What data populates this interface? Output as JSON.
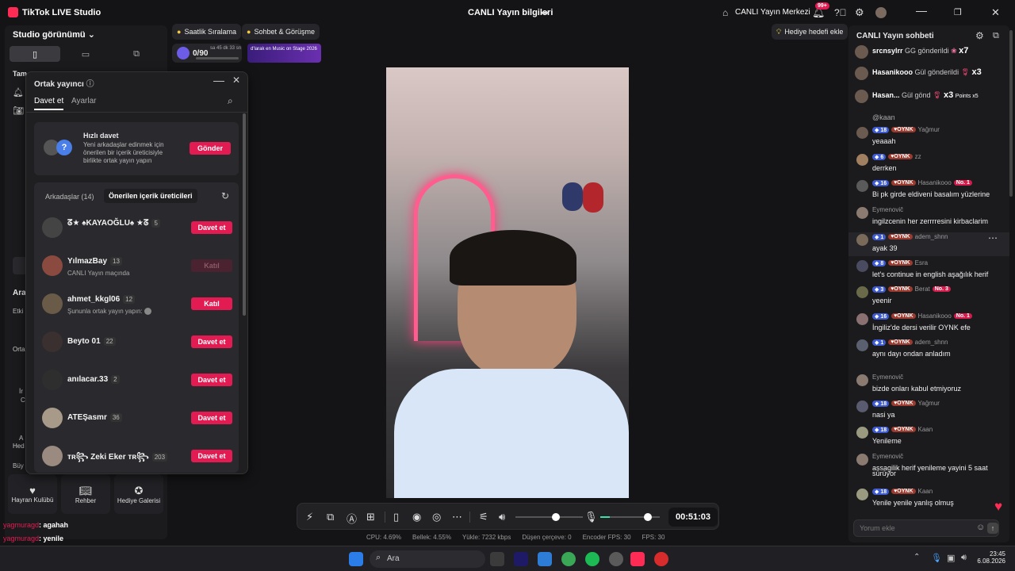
{
  "app": {
    "title": "TikTok LIVE Studio",
    "center_title": "CANLI Yayın bilgileri",
    "live_center": "CANLI Yayın Merkezi",
    "notif_badge": "99+"
  },
  "top_pills": {
    "ranking": "Saatlik Sıralama",
    "chat_meet": "Sohbet & Görüşme",
    "gift_goal": "Hediye hedefi ekle",
    "progress": "0/90",
    "timer": "sa 45 dk 33 sn",
    "banner": "d'larak en Music on Stage 2026"
  },
  "left": {
    "studio_view": "Studio görünümü",
    "tam": "Tam",
    "ara": "Ara",
    "etki": "Etki",
    "orta": "Orta",
    "ir": "İr",
    "c": "C",
    "a": "A",
    "hed": "Hed",
    "buy": "Büy",
    "cards": [
      {
        "label": "Hayran Kulübü"
      },
      {
        "label": "Rehber"
      },
      {
        "label": "Hediye Galerisi"
      }
    ],
    "overlay_chat": [
      {
        "user": "yagmuragd",
        "text": ": agahah"
      },
      {
        "user": "yagmuragd",
        "text": ": yenile"
      }
    ]
  },
  "modal": {
    "title": "Ortak yayıncı",
    "tabs": [
      "Davet et",
      "Ayarlar"
    ],
    "quick": {
      "title": "Hızlı davet",
      "desc": "Yeni arkadaşlar edinmek için önerilen bir içerik üreticisiyle birlikte ortak yayın yapın",
      "button": "Gönder"
    },
    "segments": [
      "Arkadaşlar (14)",
      "Önerilen içerik üreticileri"
    ],
    "users": [
      {
        "name": "ᘔ★ ♠KAYAOĞLU♠ ★ᘔ",
        "count": "5",
        "sub": "",
        "button": "Davet et",
        "state": "active"
      },
      {
        "name": "YılmazBay",
        "count": "13",
        "sub": "CANLI Yayın maçında",
        "button": "Katıl",
        "state": "disabled"
      },
      {
        "name": "ahmet_kkgl06",
        "count": "12",
        "sub": "Şununla ortak yayın yapın:",
        "button": "Katıl",
        "state": "active"
      },
      {
        "name": "Beyto 01",
        "count": "22",
        "sub": "",
        "button": "Davet et",
        "state": "active"
      },
      {
        "name": "anılacar.33",
        "count": "2",
        "sub": "",
        "button": "Davet et",
        "state": "active"
      },
      {
        "name": "ATEŞasmr",
        "count": "36",
        "sub": "",
        "button": "Davet et",
        "state": "active"
      },
      {
        "name": "ᴛʀ꧂ Zeki Eker ᴛʀ꧂",
        "count": "203",
        "sub": "",
        "button": "Davet et",
        "state": "active"
      }
    ]
  },
  "controls": {
    "timer": "00:51:03",
    "volume_level": 0.6,
    "mic_level": 0.8
  },
  "stats": [
    "CPU:  4.69%",
    "Bellek:  4.55%",
    "Yükle:  7232 kbps",
    "Düşen çerçeve:  0",
    "Encoder FPS:  30",
    "FPS:  30"
  ],
  "chat": {
    "title": "CANLI Yayın sohbeti",
    "gifts": [
      {
        "user": "srcnsylrr",
        "action": "GG gönderildi",
        "mult": "x7"
      },
      {
        "user": "Hasanikooo",
        "action": "Gül gönderildi",
        "mult": "x3"
      },
      {
        "user": "Hasan...",
        "action": "Gül gönd",
        "mult": "x3",
        "extra": "Points x5"
      }
    ],
    "cut_text": "@kaan",
    "messages": [
      {
        "lvl": "18",
        "fan": "OYNK",
        "user": "Yağmur",
        "no": "",
        "text": "yeaaah"
      },
      {
        "lvl": "6",
        "fan": "OYNK",
        "user": "zz",
        "no": "",
        "text": "derrken"
      },
      {
        "lvl": "16",
        "fan": "OYNK",
        "user": "Hasanikooo",
        "no": "No. 1",
        "text": "Bi pk girde eldiveni basalım yüzlerine"
      },
      {
        "lvl": "",
        "fan": "",
        "user": "Eymenovič",
        "no": "",
        "text": "ingilzcenin her zerrrresini kirbaclarim"
      },
      {
        "lvl": "1",
        "fan": "OYNK",
        "user": "adem_shnn",
        "no": "",
        "text": "ayak 39"
      },
      {
        "lvl": "8",
        "fan": "OYNK",
        "user": "Esra",
        "no": "",
        "text": "let's continue in english aşağılık herif"
      },
      {
        "lvl": "3",
        "fan": "OYNK",
        "user": "Berat",
        "no": "No. 3",
        "text": "yeenir"
      },
      {
        "lvl": "16",
        "fan": "OYNK",
        "user": "Hasanikooo",
        "no": "No. 1",
        "text": "İngiliz'de dersi verilir OYNK efe"
      },
      {
        "lvl": "1",
        "fan": "OYNK",
        "user": "adem_shnn",
        "no": "",
        "text": "aynı dayı ondan anladım"
      },
      {
        "lvl": "",
        "fan": "",
        "user": "Eymenovič",
        "no": "",
        "text": "bizde onları kabul etmiyoruz"
      },
      {
        "lvl": "18",
        "fan": "OYNK",
        "user": "Yağmur",
        "no": "",
        "text": "nasi ya"
      },
      {
        "lvl": "18",
        "fan": "OYNK",
        "user": "Kaan",
        "no": "",
        "text": "Yenileme"
      },
      {
        "lvl": "",
        "fan": "",
        "user": "Eymenovič",
        "no": "",
        "text": "assagilik herif yenileme yayini 5 saat"
      },
      {
        "lvl": "",
        "fan": "",
        "user": "",
        "no": "",
        "text": "sürüyor"
      },
      {
        "lvl": "18",
        "fan": "OYNK",
        "user": "Kaan",
        "no": "",
        "text": "Yenile yenile yanlış olmuş"
      }
    ],
    "input_placeholder": "Yorum ekle"
  },
  "taskbar": {
    "search": "Ara",
    "time": "23:45",
    "date": "6.08.2026"
  }
}
